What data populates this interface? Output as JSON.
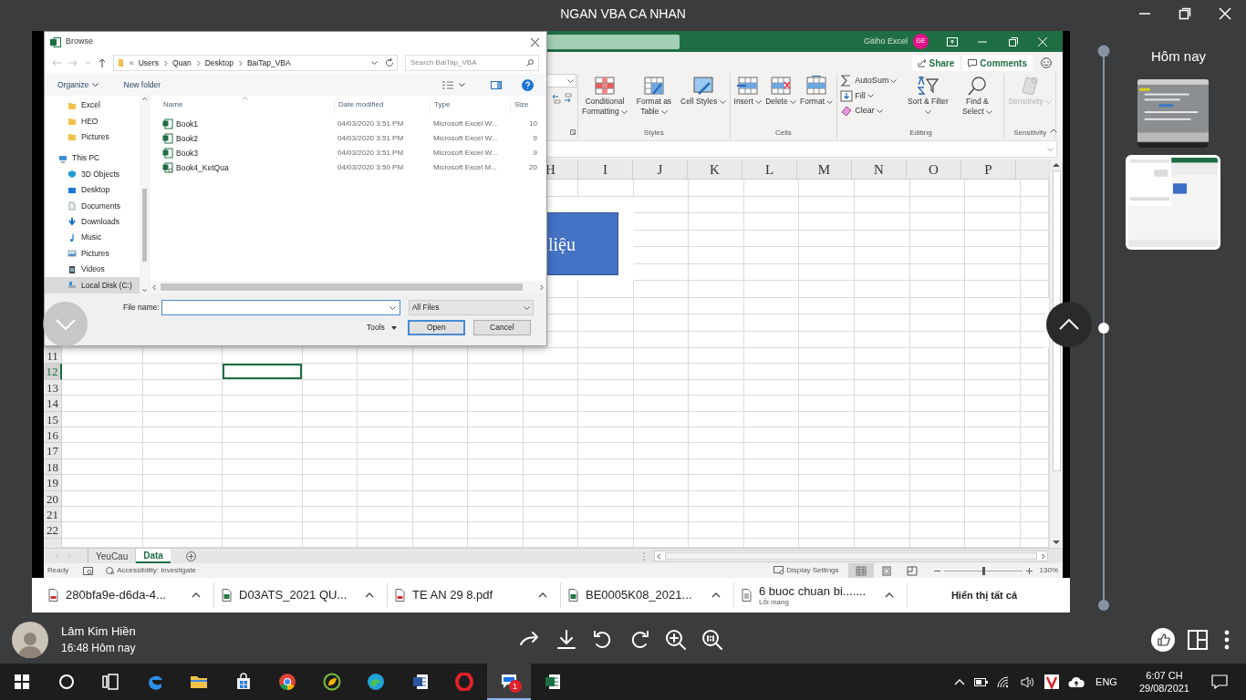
{
  "window": {
    "title": "NGAN VBA CA NHAN"
  },
  "excel": {
    "account": "Gitiho Excel",
    "avatar": "GE",
    "share": "Share",
    "comments": "Comments",
    "ribbon_groups": [
      {
        "label": "Styles",
        "commands": [
          {
            "kind": "large",
            "label": "Conditional Formatting",
            "disabled": false
          },
          {
            "kind": "large",
            "label": "Format as Table",
            "disabled": false
          },
          {
            "kind": "large",
            "label": "Cell Styles",
            "disabled": false
          }
        ]
      },
      {
        "label": "Cells",
        "commands": [
          {
            "kind": "large",
            "label": "Insert",
            "disabled": false
          },
          {
            "kind": "large",
            "label": "Delete",
            "disabled": false
          },
          {
            "kind": "large",
            "label": "Format",
            "disabled": false
          }
        ]
      },
      {
        "label": "Editing",
        "commands": [
          {
            "kind": "small",
            "label": "AutoSum",
            "disabled": false
          },
          {
            "kind": "small",
            "label": "Fill",
            "disabled": false
          },
          {
            "kind": "small",
            "label": "Clear",
            "disabled": false
          },
          {
            "kind": "large",
            "label": "Sort & Filter",
            "disabled": false
          },
          {
            "kind": "large",
            "label": "Find & Select",
            "disabled": false
          }
        ]
      },
      {
        "label": "Sensitivity",
        "commands": [
          {
            "kind": "large",
            "label": "Sensitivity",
            "disabled": true
          }
        ]
      }
    ],
    "columns": [
      "H",
      "I",
      "J",
      "K",
      "L",
      "M",
      "N",
      "O",
      "P"
    ],
    "rows": [
      {
        "label": "11",
        "selected": false
      },
      {
        "label": "12",
        "selected": true
      },
      {
        "label": "13",
        "selected": false
      },
      {
        "label": "14",
        "selected": false
      },
      {
        "label": "15",
        "selected": false
      },
      {
        "label": "16",
        "selected": false
      },
      {
        "label": "17",
        "selected": false
      },
      {
        "label": "18",
        "selected": false
      },
      {
        "label": "19",
        "selected": false
      },
      {
        "label": "20",
        "selected": false
      },
      {
        "label": "21",
        "selected": false
      },
      {
        "label": "22",
        "selected": false
      }
    ],
    "shape": {
      "text": "liệu"
    },
    "sheets": [
      {
        "label": "YeuCau",
        "selected": false
      },
      {
        "label": "Data",
        "selected": true
      }
    ],
    "status": {
      "ready": "Ready",
      "accessibility": "Accessibility: Investigate",
      "display_settings": "Display Settings",
      "views": [
        {
          "selected": true
        },
        {
          "selected": false
        },
        {
          "selected": false
        }
      ],
      "zoom": {
        "level": 0.51,
        "reading": "130%"
      }
    }
  },
  "dialog": {
    "title": "Browse",
    "path_overflow": "«",
    "path": [
      "Users",
      "Quan",
      "Desktop",
      "BaiTap_VBA"
    ],
    "search_placeholder": "Search BaiTap_VBA",
    "organize": "Organize",
    "new_folder": "New folder",
    "nav": [
      {
        "kind": "folder",
        "label": "Excel",
        "selected": false
      },
      {
        "kind": "folder",
        "label": "HEO",
        "selected": false
      },
      {
        "kind": "folder",
        "label": "Pictures",
        "selected": false
      },
      {
        "kind": "computer",
        "label": "This PC",
        "selected": false,
        "children": [
          {
            "kind": "objects",
            "label": "3D Objects",
            "selected": false
          },
          {
            "kind": "desktop",
            "label": "Desktop",
            "selected": false
          },
          {
            "kind": "documents",
            "label": "Documents",
            "selected": false
          },
          {
            "kind": "downloads",
            "label": "Downloads",
            "selected": false
          },
          {
            "kind": "music",
            "label": "Music",
            "selected": false
          },
          {
            "kind": "pictures",
            "label": "Pictures",
            "selected": false
          },
          {
            "kind": "videos",
            "label": "Videos",
            "selected": false
          },
          {
            "kind": "drive",
            "label": "Local Disk (C:)",
            "selected": true
          }
        ]
      }
    ],
    "columns": [
      "Name",
      "Date modified",
      "Type",
      "Size"
    ],
    "files": [
      {
        "kind": "workbook",
        "name": "Book1",
        "date": "04/03/2020 3:51 PM",
        "type": "Microsoft Excel W...",
        "size": "10"
      },
      {
        "kind": "workbook",
        "name": "Book2",
        "date": "04/03/2020 3:51 PM",
        "type": "Microsoft Excel W...",
        "size": "9"
      },
      {
        "kind": "workbook",
        "name": "Book3",
        "date": "04/03/2020 3:51 PM",
        "type": "Microsoft Excel W...",
        "size": "9"
      },
      {
        "kind": "macro",
        "name": "Book4_KetQua",
        "date": "04/03/2020 3:50 PM",
        "type": "Microsoft Excel M...",
        "size": "20"
      }
    ],
    "file_name_label": "File name:",
    "filter": "All Files",
    "tools": "Tools",
    "open": "Open",
    "cancel": "Cancel"
  },
  "downloads": {
    "items": [
      {
        "kind": "pdf",
        "name": "280bfa9e-d6da-4..."
      },
      {
        "kind": "excel",
        "name": "D03ATS_2021 QU..."
      },
      {
        "kind": "pdf",
        "name": "TE AN 29 8.pdf"
      },
      {
        "kind": "excel",
        "name": "BE0005K08_2021..."
      },
      {
        "kind": "file",
        "name": "6 buoc chuan bi.......",
        "status": "Lỗi mạng"
      }
    ],
    "show_all": "Hiển thị tất cả"
  },
  "sender": {
    "name": "Lâm Kim Hiền",
    "time": "16:48 Hôm nay"
  },
  "history": {
    "heading": "Hôm nay",
    "thumbnails": [
      {
        "selected": false
      },
      {
        "selected": true
      }
    ]
  },
  "taskbar": {
    "apps": [
      {
        "kind": "start",
        "active": false
      },
      {
        "kind": "search",
        "active": false
      },
      {
        "kind": "taskview",
        "active": false
      },
      {
        "kind": "browser-e",
        "active": false
      },
      {
        "kind": "folder",
        "active": false
      },
      {
        "kind": "bag",
        "active": false
      },
      {
        "kind": "chrome",
        "active": false
      },
      {
        "kind": "leaf",
        "active": false
      },
      {
        "kind": "wave",
        "active": false
      },
      {
        "kind": "word",
        "active": false
      },
      {
        "kind": "ring",
        "active": false
      },
      {
        "kind": "chat",
        "active": true,
        "badge": "1"
      },
      {
        "kind": "sheet",
        "active": false
      }
    ],
    "tray": {
      "language": "ENG",
      "time": "6:07 CH",
      "date": "29/08/2021"
    }
  }
}
